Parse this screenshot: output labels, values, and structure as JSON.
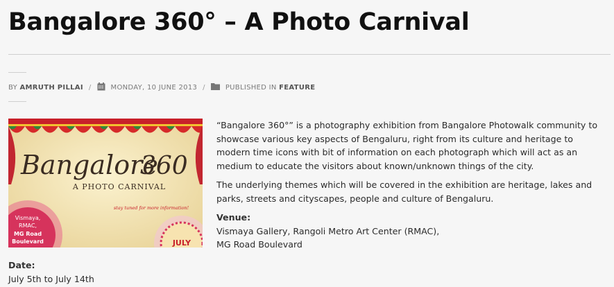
{
  "article": {
    "title": "Bangalore 360° – A Photo Carnival",
    "meta": {
      "by_prefix": "BY",
      "author": "AMRUTH PILLAI",
      "date": "MONDAY, 10 JUNE 2013",
      "published_prefix": "PUBLISHED IN",
      "category": "FEATURE"
    },
    "poster": {
      "word1": "Bangalore",
      "word2": "360",
      "subtitle": "A PHOTO CARNIVAL",
      "tagline": "stay tuned for more information!",
      "venue_lines": [
        "Vismaya,",
        "RMAC,",
        "MG Road",
        "Boulevard"
      ],
      "month": "JULY"
    },
    "paragraph1": "“Bangalore 360°” is a photography exhibition from Bangalore Photowalk community to showcase various key aspects of Bengaluru, right from its culture and heritage to modern time icons with bit of information on each photograph which will act as an medium to educate the visitors about known/unknown things of the city.",
    "paragraph2": "The underlying themes which will be covered in the exhibition are heritage, lakes and parks, streets and cityscapes, people and culture of Bengaluru.",
    "venue": {
      "label": "Venue:",
      "line1": "Vismaya Gallery, Rangoli Metro Art Center (RMAC),",
      "line2": "MG Road Boulevard"
    },
    "date": {
      "label": "Date:",
      "value": "July 5th to July 14th"
    }
  }
}
